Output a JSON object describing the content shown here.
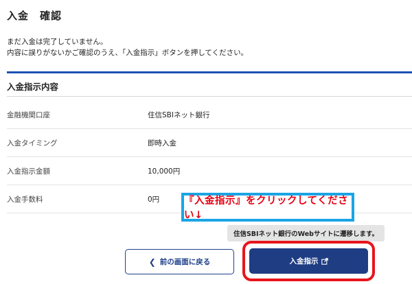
{
  "header": {
    "title": "入金　確認"
  },
  "notice": {
    "line1": "まだ入金は完了していません。",
    "line2": "内容に誤りがないかご確認のうえ、「入金指示」ボタンを押してください。"
  },
  "section": {
    "heading": "入金指示内容"
  },
  "details": [
    {
      "label": "金融機関口座",
      "value": "住信SBIネット銀行"
    },
    {
      "label": "入金タイミング",
      "value": "即時入金"
    },
    {
      "label": "入金指示金額",
      "value": "10,000円"
    },
    {
      "label": "入金手数料",
      "value": "0円"
    }
  ],
  "callout": {
    "text": "『入金指示』をクリックしてください↓",
    "text_color": "#e60012",
    "border_color": "#1aa4e6"
  },
  "transition_note": "住信SBIネット銀行のWebサイトに遷移します。",
  "buttons": {
    "back_label": "前の画面に戻る",
    "back_icon": "chevron-left-icon",
    "submit_label": "入金指示",
    "submit_icon": "external-link-icon",
    "submit_color": "#1f3d83",
    "highlight_color": "#e8151b"
  }
}
